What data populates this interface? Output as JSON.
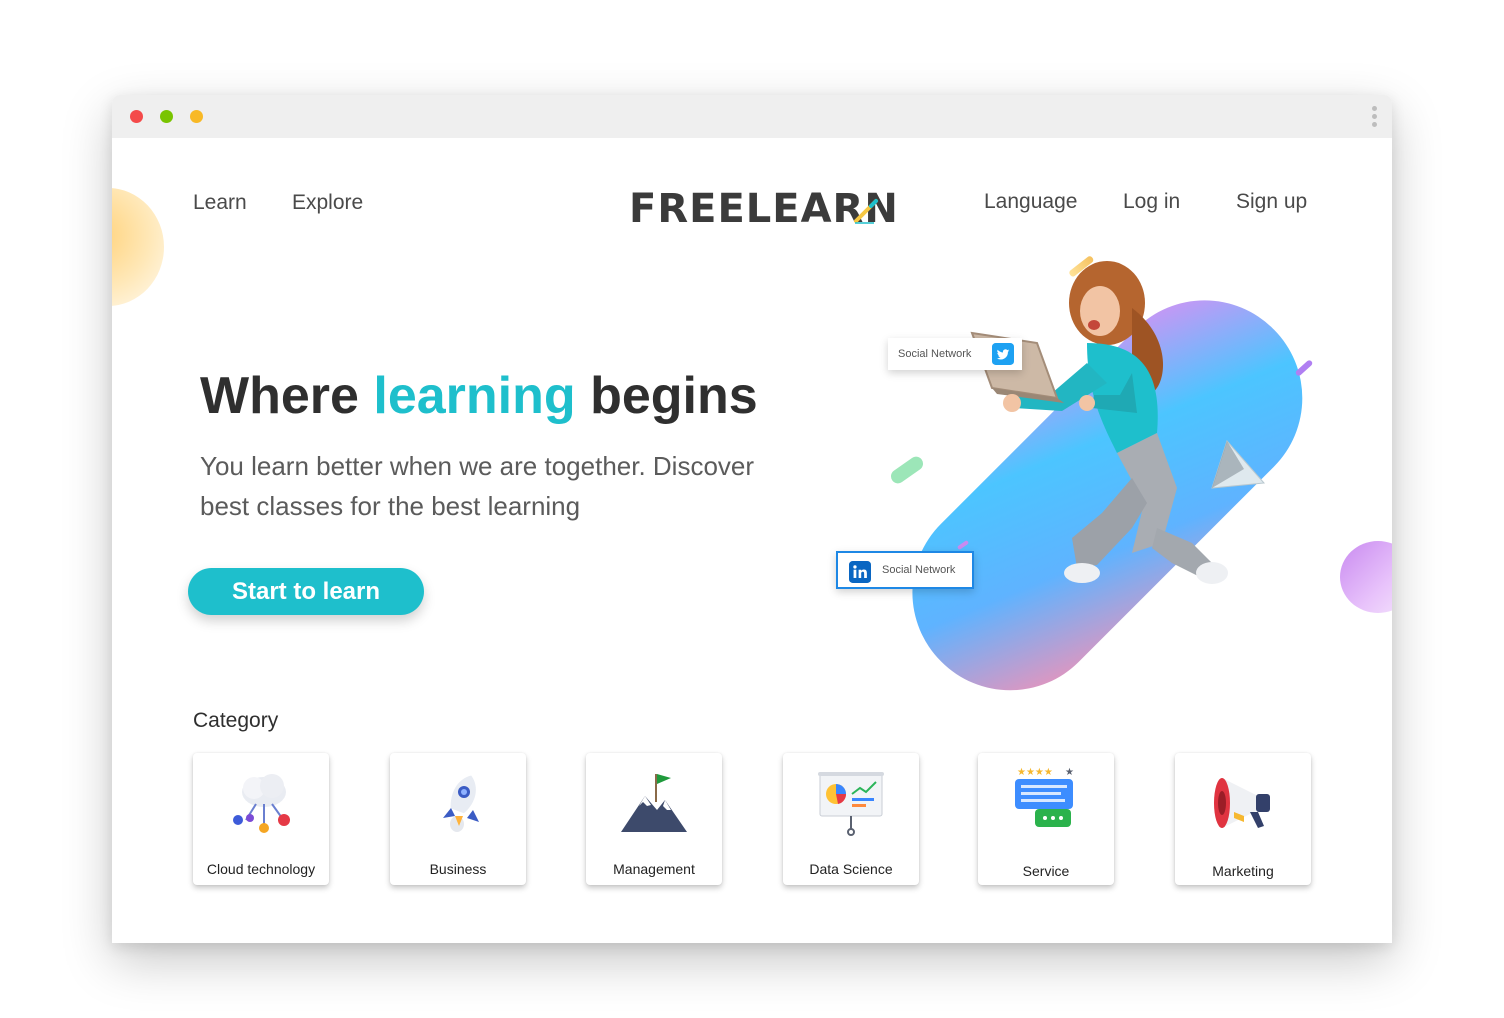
{
  "window": {
    "controls": [
      "close",
      "minimize",
      "maximize"
    ],
    "menu_icon": "kebab-menu-icon"
  },
  "nav": {
    "left": [
      {
        "label": "Learn"
      },
      {
        "label": "Explore"
      }
    ],
    "logo": "FREELEARN",
    "logo_icon": "pencil-icon",
    "right": [
      {
        "label": "Language"
      },
      {
        "label": "Log in"
      },
      {
        "label": "Sign up"
      }
    ]
  },
  "hero": {
    "title_part1": "Where ",
    "title_accent": "learning",
    "title_part2": " begins",
    "subtitle": "You learn better when we are together. Discover best classes for the best learning",
    "cta_label": "Start to learn",
    "badges": [
      {
        "label": "Social Network",
        "icon": "twitter-icon"
      },
      {
        "label": "Social Network",
        "icon": "linkedin-icon"
      }
    ]
  },
  "category": {
    "title": "Category",
    "items": [
      {
        "label": "Cloud technology",
        "icon": "cloud-network-icon"
      },
      {
        "label": "Business",
        "icon": "rocket-icon"
      },
      {
        "label": "Management",
        "icon": "mountain-flag-icon"
      },
      {
        "label": "Data Science",
        "icon": "chart-board-icon"
      },
      {
        "label": "Service",
        "icon": "chat-rating-icon"
      },
      {
        "label": "Marketing",
        "icon": "megaphone-icon"
      }
    ]
  },
  "colors": {
    "accent": "#1ebfcc",
    "text_dark": "#2f2f2f",
    "twitter": "#1da1f2",
    "linkedin": "#0a66c2"
  }
}
